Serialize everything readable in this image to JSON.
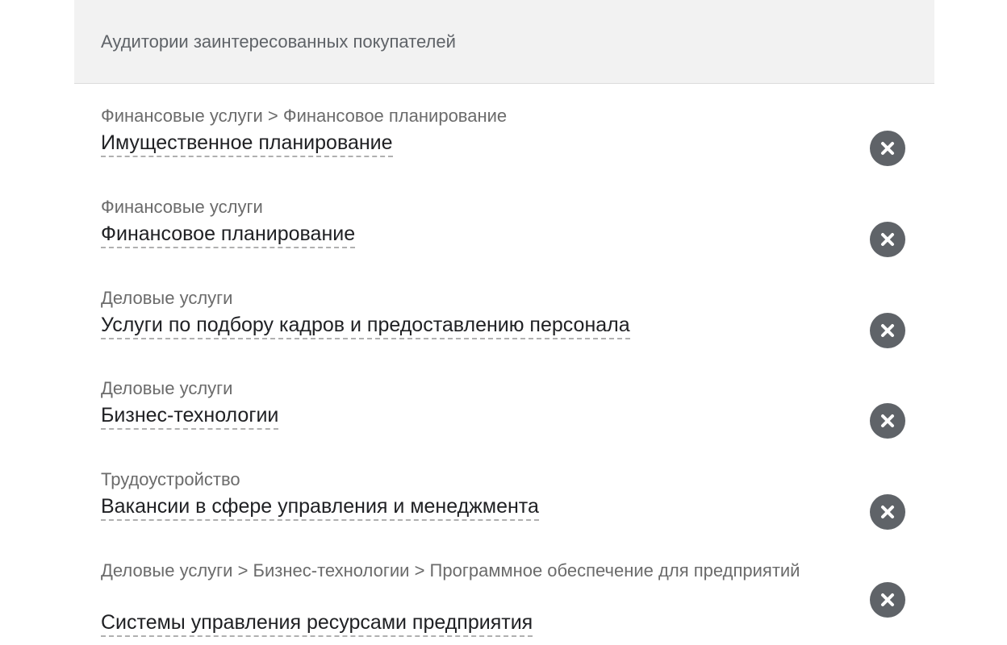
{
  "panel": {
    "title": "Аудитории заинтересованных покупателей"
  },
  "audiences": [
    {
      "path": "Финансовые услуги > Финансовое планирование",
      "name": "Имущественное планирование",
      "remove_icon": "remove-circle-icon"
    },
    {
      "path": "Финансовые услуги",
      "name": "Финансовое планирование",
      "remove_icon": "remove-circle-icon"
    },
    {
      "path": "Деловые услуги",
      "name": "Услуги по подбору кадров и предоставлению персонала",
      "remove_icon": "remove-circle-icon"
    },
    {
      "path": "Деловые услуги",
      "name": "Бизнес-технологии",
      "remove_icon": "remove-circle-icon"
    },
    {
      "path": "Трудоустройство",
      "name": "Вакансии в сфере управления и менеджмента",
      "remove_icon": "remove-circle-icon"
    },
    {
      "path": "Деловые услуги > Бизнес-технологии > Программное обеспечение для предприятий",
      "name": "Системы управления ресурсами предприятия",
      "remove_icon": "remove-circle-icon"
    }
  ],
  "colors": {
    "header_bg": "#f2f2f2",
    "icon": "#5f6368",
    "text_primary": "#202124",
    "text_secondary": "#6b6b6b"
  }
}
